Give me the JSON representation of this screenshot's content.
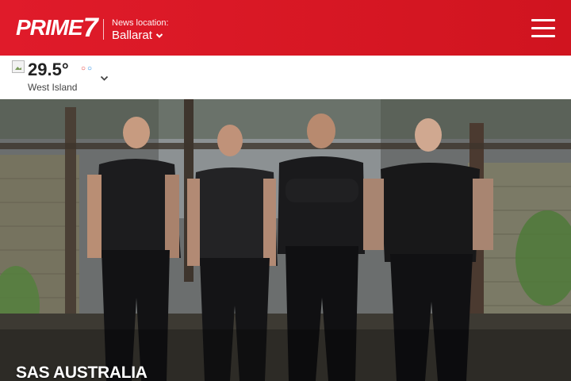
{
  "header": {
    "brand_word": "PRIME",
    "brand_number": "7",
    "location_label": "News location:",
    "location_value": "Ballarat",
    "menu_icon": "hamburger-menu-icon",
    "background_color": "#d9192a"
  },
  "weather": {
    "icon": "weather-condition-icon",
    "temperature": "29.5°",
    "place": "West Island",
    "expand_icon": "chevron-down-icon"
  },
  "hero": {
    "caption": "SAS AUSTRALIA",
    "image": "four-men-in-black-uniforms-standing-in-ruined-brick-building"
  }
}
